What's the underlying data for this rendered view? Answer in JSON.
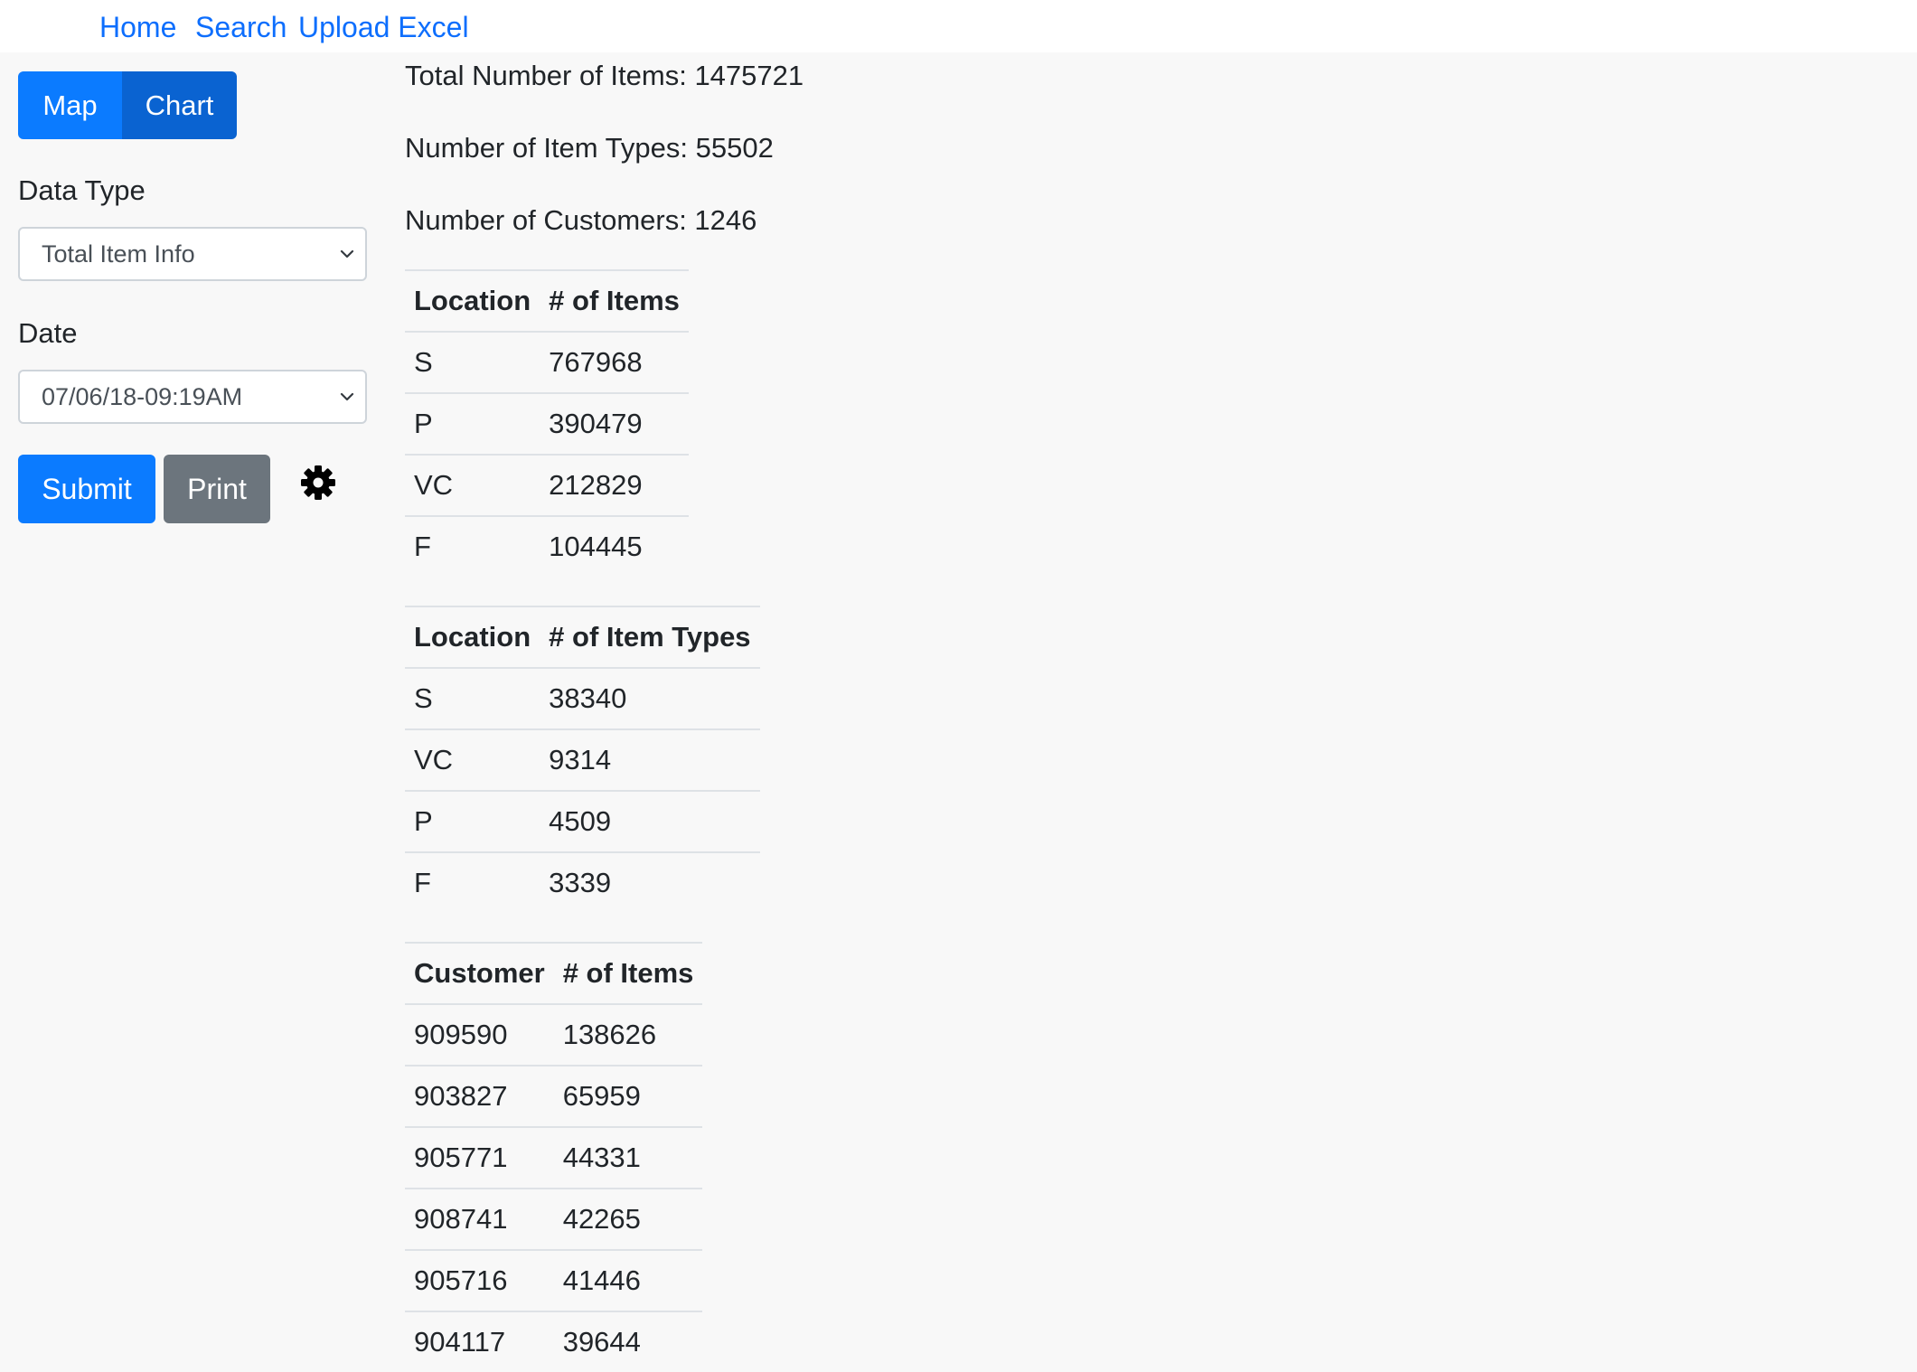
{
  "nav": {
    "home": "Home",
    "search": "Search",
    "upload": "Upload Excel"
  },
  "sidebar": {
    "view_toggle": {
      "map_label": "Map",
      "chart_label": "Chart",
      "active": "Chart"
    },
    "data_type_label": "Data Type",
    "data_type_value": "Total Item Info",
    "date_label": "Date",
    "date_value": "07/06/18-09:19AM",
    "submit_label": "Submit",
    "print_label": "Print",
    "settings_icon": "gear-icon"
  },
  "stats": {
    "total_items": "Total Number of Items: 1475721",
    "item_types": "Number of Item Types: 55502",
    "customers": "Number of Customers: 1246"
  },
  "tables": {
    "items_by_location": {
      "headers": [
        "Location",
        "# of Items"
      ],
      "rows": [
        [
          "S",
          "767968"
        ],
        [
          "P",
          "390479"
        ],
        [
          "VC",
          "212829"
        ],
        [
          "F",
          "104445"
        ]
      ]
    },
    "types_by_location": {
      "headers": [
        "Location",
        "# of Item Types"
      ],
      "rows": [
        [
          "S",
          "38340"
        ],
        [
          "VC",
          "9314"
        ],
        [
          "P",
          "4509"
        ],
        [
          "F",
          "3339"
        ]
      ]
    },
    "items_by_customer": {
      "headers": [
        "Customer",
        "# of Items"
      ],
      "rows": [
        [
          "909590",
          "138626"
        ],
        [
          "903827",
          "65959"
        ],
        [
          "905771",
          "44331"
        ],
        [
          "908741",
          "42265"
        ],
        [
          "905716",
          "41446"
        ],
        [
          "904117",
          "39644"
        ]
      ]
    }
  },
  "colors": {
    "primary": "#0b7bff",
    "primary_active": "#0a63d1",
    "secondary": "#6c757d",
    "link": "#0d6efd",
    "background": "#f8f8f8"
  }
}
